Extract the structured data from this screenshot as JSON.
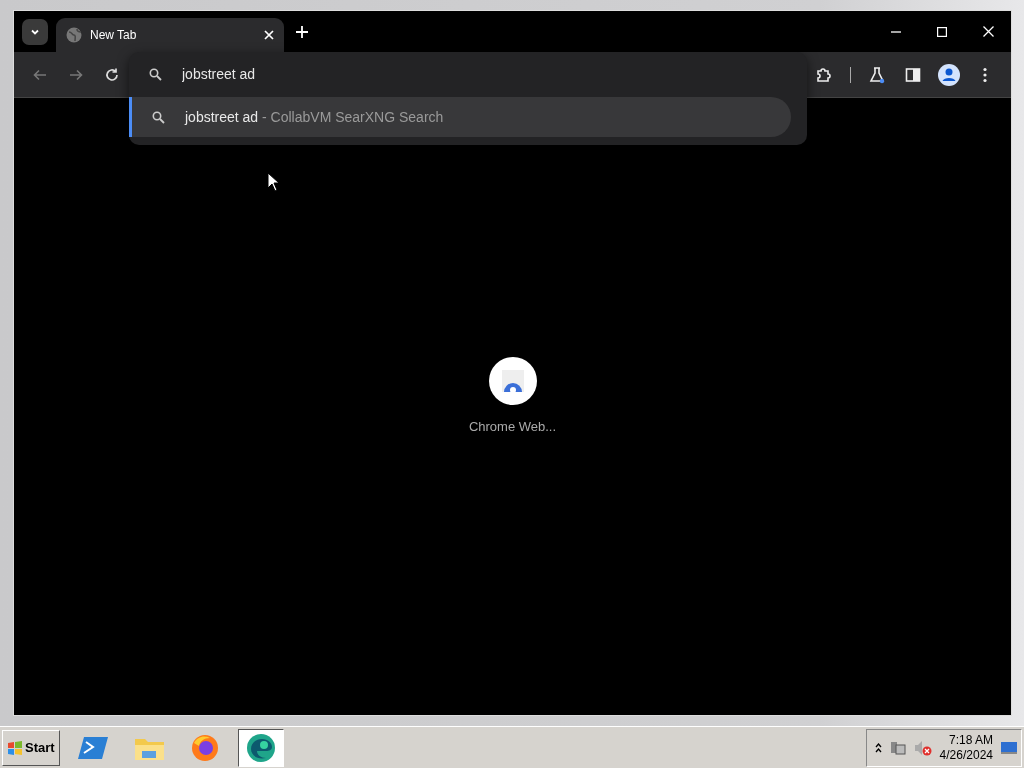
{
  "tabs": [
    {
      "title": "New Tab",
      "selected": true
    }
  ],
  "omnibox": {
    "value": "jobstreet ad"
  },
  "suggestions": [
    {
      "query": "jobstreet ad",
      "source": "- CollabVM SearXNG Search",
      "selected": true
    }
  ],
  "shortcuts": [
    {
      "label": "Chrome Web..."
    }
  ],
  "taskbar": {
    "start": "Start",
    "apps": [
      {
        "kind": "powershell",
        "active": false
      },
      {
        "kind": "explorer",
        "active": false
      },
      {
        "kind": "firefox",
        "active": false
      },
      {
        "kind": "edge",
        "active": true
      }
    ],
    "clock": {
      "time": "7:18 AM",
      "date": "4/26/2024"
    }
  }
}
